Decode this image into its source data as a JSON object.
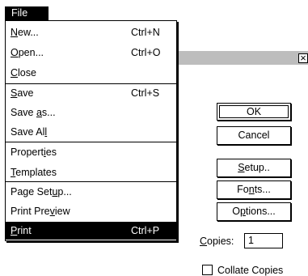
{
  "menu": {
    "title": "File",
    "items": [
      {
        "label_pre": "",
        "label_u": "N",
        "label_post": "ew...",
        "shortcut": "Ctrl+N"
      },
      {
        "label_pre": "",
        "label_u": "O",
        "label_post": "pen...",
        "shortcut": "Ctrl+O"
      },
      {
        "label_pre": "",
        "label_u": "C",
        "label_post": "lose",
        "shortcut": ""
      },
      {
        "label_pre": "",
        "label_u": "S",
        "label_post": "ave",
        "shortcut": "Ctrl+S"
      },
      {
        "label_pre": "Save ",
        "label_u": "a",
        "label_post": "s...",
        "shortcut": ""
      },
      {
        "label_pre": "Save Al",
        "label_u": "l",
        "label_post": "",
        "shortcut": ""
      },
      {
        "label_pre": "Propert",
        "label_u": "i",
        "label_post": "es",
        "shortcut": ""
      },
      {
        "label_pre": "",
        "label_u": "T",
        "label_post": "emplates",
        "shortcut": ""
      },
      {
        "label_pre": "Page Set",
        "label_u": "u",
        "label_post": "p...",
        "shortcut": ""
      },
      {
        "label_pre": "Print Pre",
        "label_u": "v",
        "label_post": "iew",
        "shortcut": ""
      },
      {
        "label_pre": "",
        "label_u": "P",
        "label_post": "rint",
        "shortcut": "Ctrl+P"
      }
    ]
  },
  "dialog": {
    "close_glyph": "×",
    "ok_label": "OK",
    "cancel_label": "Cancel",
    "setup": {
      "pre": "",
      "u": "S",
      "post": "etup.."
    },
    "fonts": {
      "pre": "Fo",
      "u": "n",
      "post": "ts..."
    },
    "options": {
      "pre": "O",
      "u": "p",
      "post": "tions..."
    },
    "copies_pre": "",
    "copies_u": "C",
    "copies_post": "opies:",
    "copies_value": "1",
    "collate_label": "Collate Copies"
  }
}
